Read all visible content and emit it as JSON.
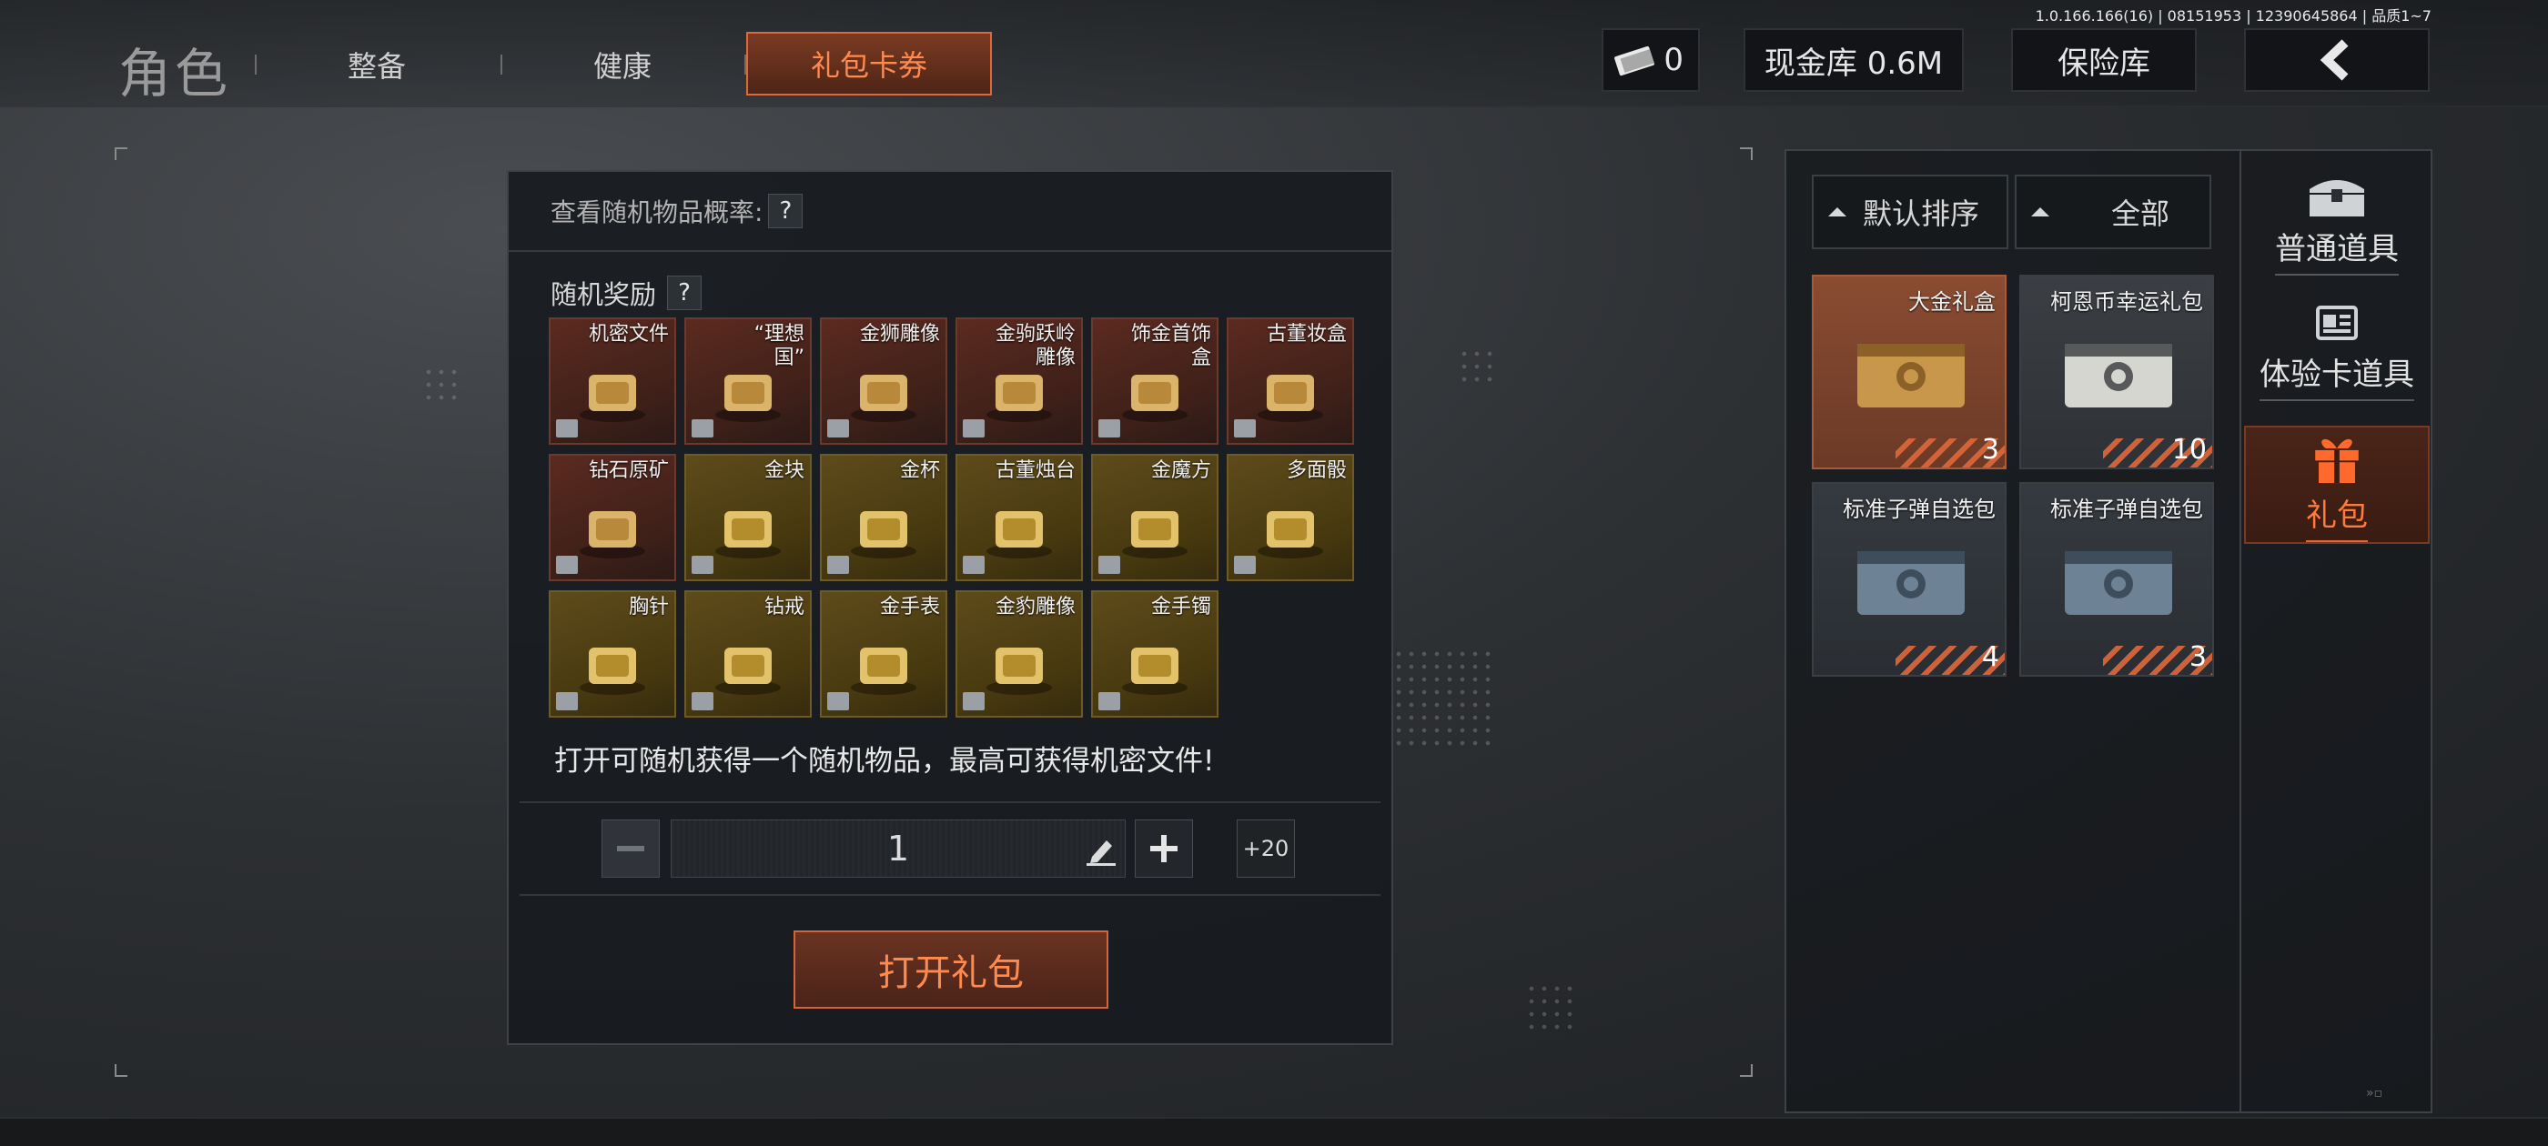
{
  "version": "1.0.166.166(16) | 08151953 | 12390645864 | 品质1~7",
  "header": {
    "title": "角色",
    "tabs": [
      {
        "label": "整备"
      },
      {
        "label": "健康"
      },
      {
        "label": "礼包卡券",
        "active": true
      }
    ],
    "currency_count": "0",
    "cash_label": "现金库 0.6M",
    "vault_label": "保险库"
  },
  "gift": {
    "prob_label": "查看随机物品概率:",
    "prob_help": "?",
    "reward_title": "随机奖励",
    "reward_help": "?",
    "items": [
      {
        "label": "机密文件",
        "rarity": "red",
        "icon": "classified-file-icon"
      },
      {
        "label": "“理想\n国”",
        "rarity": "red",
        "icon": "ideal-nation-crate-icon"
      },
      {
        "label": "金狮雕像",
        "rarity": "red",
        "icon": "gold-lion-statue-icon"
      },
      {
        "label": "金驹跃岭\n雕像",
        "rarity": "red",
        "icon": "gold-horse-statue-icon"
      },
      {
        "label": "饰金首饰\n盒",
        "rarity": "red",
        "icon": "jewelry-box-icon"
      },
      {
        "label": "古董妆盒",
        "rarity": "red",
        "icon": "antique-case-icon"
      },
      {
        "label": "钻石原矿",
        "rarity": "red",
        "icon": "raw-diamond-icon"
      },
      {
        "label": "金块",
        "rarity": "gold",
        "icon": "gold-bar-icon"
      },
      {
        "label": "金杯",
        "rarity": "gold",
        "icon": "gold-cup-icon"
      },
      {
        "label": "古董烛台",
        "rarity": "gold",
        "icon": "candlestick-icon"
      },
      {
        "label": "金魔方",
        "rarity": "gold",
        "icon": "gold-cube-icon"
      },
      {
        "label": "多面骰",
        "rarity": "gold",
        "icon": "dice-icon"
      },
      {
        "label": "胸针",
        "rarity": "gold",
        "icon": "brooch-icon"
      },
      {
        "label": "钻戒",
        "rarity": "gold",
        "icon": "diamond-ring-icon"
      },
      {
        "label": "金手表",
        "rarity": "gold",
        "icon": "gold-watch-icon"
      },
      {
        "label": "金豹雕像",
        "rarity": "gold",
        "icon": "gold-leopard-icon"
      },
      {
        "label": "金手镯",
        "rarity": "gold",
        "icon": "gold-bracelet-icon"
      }
    ],
    "description": "打开可随机获得一个随机物品，最高可获得机密文件!",
    "quantity": "1",
    "plus20_label": "+20",
    "open_label": "打开礼包"
  },
  "inventory": {
    "sort_label": "默认排序",
    "filter_label": "全部",
    "cards": [
      {
        "label": "大金礼盒",
        "count": "3",
        "style": "red",
        "icon": "gold-gift-box-icon"
      },
      {
        "label": "柯恩币幸运礼包",
        "count": "10",
        "style": "grey",
        "icon": "coin-case-icon"
      },
      {
        "label": "标准子弹自选包",
        "count": "4",
        "style": "slate",
        "icon": "ammo-box-icon"
      },
      {
        "label": "标准子弹自选包",
        "count": "3",
        "style": "slate",
        "icon": "ammo-box-icon"
      }
    ],
    "categories": [
      {
        "label": "普通道具",
        "icon": "chest-icon"
      },
      {
        "label": "体验卡道具",
        "icon": "card-icon"
      },
      {
        "label": "礼包",
        "icon": "gift-icon",
        "active": true
      }
    ]
  },
  "colors": {
    "accent": "#e0673a",
    "accent_text": "#ff8a4f",
    "panel": "#181b1f"
  }
}
